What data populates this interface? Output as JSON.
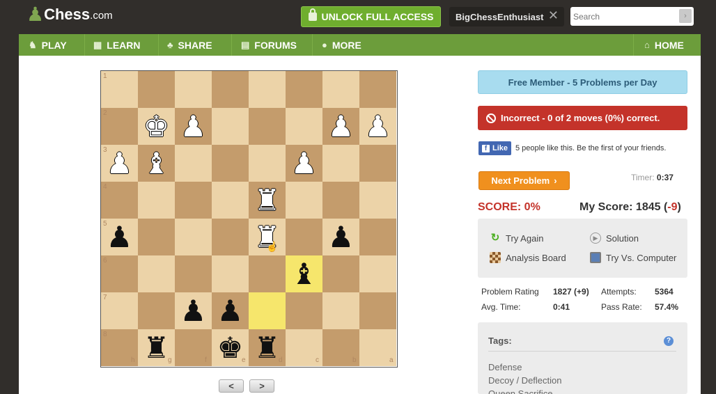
{
  "header": {
    "logo_text": "Chess",
    "logo_domain": ".com",
    "unlock_label": "UNLOCK FULL ACCESS",
    "username": "BigChessEnthusiast",
    "close_glyph": "✕",
    "search_placeholder": "Search",
    "search_go": "›"
  },
  "nav": {
    "items": [
      {
        "label": "PLAY",
        "icon": "play-icon"
      },
      {
        "label": "LEARN",
        "icon": "learn-icon"
      },
      {
        "label": "SHARE",
        "icon": "share-icon"
      },
      {
        "label": "FORUMS",
        "icon": "forums-icon"
      },
      {
        "label": "MORE",
        "icon": "more-icon"
      },
      {
        "label": "HOME",
        "icon": "home-icon"
      }
    ]
  },
  "board": {
    "ranks": [
      "1",
      "2",
      "3",
      "4",
      "5",
      "6",
      "7",
      "8"
    ],
    "files": [
      "h",
      "g",
      "f",
      "e",
      "d",
      "c",
      "b",
      "a"
    ],
    "highlighted": [
      "d7",
      "c6"
    ],
    "pieces": [
      {
        "glyph": "♚",
        "color": "w",
        "square": "g2"
      },
      {
        "glyph": "♟",
        "color": "w",
        "square": "f2"
      },
      {
        "glyph": "♟",
        "color": "w",
        "square": "b2"
      },
      {
        "glyph": "♟",
        "color": "w",
        "square": "a2"
      },
      {
        "glyph": "♟",
        "color": "w",
        "square": "h3"
      },
      {
        "glyph": "♝",
        "color": "w",
        "square": "g3"
      },
      {
        "glyph": "♟",
        "color": "w",
        "square": "c3"
      },
      {
        "glyph": "♜",
        "color": "w",
        "square": "d4"
      },
      {
        "glyph": "♜",
        "color": "w",
        "square": "d5"
      },
      {
        "glyph": "♟",
        "color": "b",
        "square": "h5"
      },
      {
        "glyph": "♟",
        "color": "b",
        "square": "b5"
      },
      {
        "glyph": "♝",
        "color": "b",
        "square": "c6"
      },
      {
        "glyph": "♟",
        "color": "b",
        "square": "f7"
      },
      {
        "glyph": "♟",
        "color": "b",
        "square": "e7"
      },
      {
        "glyph": "♜",
        "color": "b",
        "square": "g8"
      },
      {
        "glyph": "♚",
        "color": "b",
        "square": "e8"
      },
      {
        "glyph": "♜",
        "color": "b",
        "square": "d8"
      }
    ],
    "prev_label": "<",
    "next_label": ">"
  },
  "panel": {
    "membership": "Free Member - 5 Problems per Day",
    "result": "Incorrect - 0 of 2 moves (0%) correct.",
    "like_label": "Like",
    "like_text": "5 people like this. Be the first of your friends.",
    "next_problem": "Next Problem",
    "timer_label": "Timer:",
    "timer_value": "0:37",
    "score_text": "SCORE: 0%",
    "my_score_label": "My Score: 1845 (",
    "my_score_delta": "-9",
    "my_score_close": ")",
    "actions": [
      {
        "label": "Try Again",
        "icon": "retry-icon"
      },
      {
        "label": "Solution",
        "icon": "solution-icon"
      },
      {
        "label": "Analysis Board",
        "icon": "analysis-board-icon"
      },
      {
        "label": "Try Vs. Computer",
        "icon": "computer-icon"
      }
    ],
    "stats": {
      "rating_label": "Problem Rating",
      "rating_value": "1827 (+9)",
      "attempts_label": "Attempts:",
      "attempts_value": "5364",
      "avg_label": "Avg. Time:",
      "avg_value": "0:41",
      "pass_label": "Pass Rate:",
      "pass_value": "57.4%"
    },
    "tags_title": "Tags:",
    "tags_help": "?",
    "tags": [
      "Defense",
      "Decoy / Deflection",
      "Queen Sacrifice"
    ]
  },
  "colors": {
    "nav_green": "#6c9d3b",
    "unlock_green": "#6fae2e",
    "incorrect_red": "#c4332a",
    "next_orange": "#f0901e",
    "free_blue": "#a8dcef"
  }
}
